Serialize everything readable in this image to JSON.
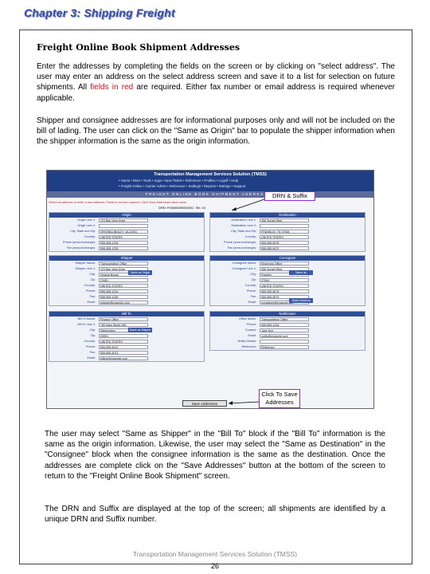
{
  "chapter": "Chapter 3:  Shipping Freight",
  "section_heading": "Freight Online Book Shipment Addresses",
  "paragraph1_before": "Enter the addresses by completing the fields on the screen or by clicking on \"select address\".  The user may enter an address on the select address screen and save it to a list for selection on future shipments.  All ",
  "paragraph1_red": "fields in red",
  "paragraph1_after": " are required.  Either fax number or email address is required whenever applicable.",
  "paragraph2": "Shipper and consignee addresses are for informational purposes only and will not be included on the bill of lading.  The user can click on the \"Same as Origin\" bar to populate the shipper information when the shipper information is the same as the origin information.",
  "screenshot": {
    "system_name": "Transportation Management Services Solution (TMSS)",
    "nav1": "• Home • Rein • Tools • Apps • New TMSS • Reference • Profiles • Logoff • Help",
    "nav2": "• Freight Online • Carrier Admin • Reference • Settings • Reports • Ratings • Support",
    "page_title": "FREIGHT ONLINE BOOK SHIPMENT ADDRESSES",
    "instruction": "Select an address or enter a new address. Fields in red are required. Click Save Addresses when done.",
    "drn_label": "DRN:",
    "drn_value": "F00000000000001",
    "suffix_label": "Sfx:",
    "suffix_value": "01",
    "origin_header": "Origin",
    "destination_header": "Destination",
    "shipper_header": "Shipper",
    "consignee_header": "Consignee",
    "billto_header": "Bill To",
    "notify_header": "Notification",
    "origin_fields": [
      {
        "label": "Origin Line 1:",
        "value": "123 Bay View Drive"
      },
      {
        "label": "Origin Line 2:",
        "value": ""
      },
      {
        "label": "City, State and Zip:",
        "value": "VIRGINIA BEACH, VA 23451"
      },
      {
        "label": "Country:",
        "value": "UNITED STATES"
      },
      {
        "label": "Phone (area-exchange):",
        "value": "555-555-1234"
      },
      {
        "label": "Fax (area-exchange):",
        "value": "555-555-1235"
      }
    ],
    "destination_fields": [
      {
        "label": "Destination Line 1:",
        "value": "456 Sunset Blvd"
      },
      {
        "label": "Destination Line 2:",
        "value": ""
      },
      {
        "label": "City, State and Zip:",
        "value": "FRANKLIN, TN 37064"
      },
      {
        "label": "Country:",
        "value": "UNITED STATES"
      },
      {
        "label": "Phone (area-exchange):",
        "value": "555-555-5678"
      },
      {
        "label": "Fax (area-exchange):",
        "value": "555-555-5679"
      }
    ],
    "shipper_fields": [
      {
        "label": "Shipper Name:",
        "value": "Transportation Office"
      },
      {
        "label": "Shipper Line 1:",
        "value": "123 Bay View Drive"
      },
      {
        "label": "City:",
        "value": "Virginia Beach"
      },
      {
        "label": "Zip:",
        "value": "23451"
      },
      {
        "label": "Country:",
        "value": "UNITED STATES"
      },
      {
        "label": "Phone:",
        "value": "555-555-1234"
      },
      {
        "label": "Fax:",
        "value": "555-555-1235"
      },
      {
        "label": "Email:",
        "value": "shipper@example.com"
      }
    ],
    "consignee_fields": [
      {
        "label": "Consignee Name:",
        "value": "Receiving Office"
      },
      {
        "label": "Consignee Line 1:",
        "value": "456 Sunset Blvd"
      },
      {
        "label": "City:",
        "value": "Franklin"
      },
      {
        "label": "Zip:",
        "value": "37064"
      },
      {
        "label": "Country:",
        "value": "UNITED STATES"
      },
      {
        "label": "Phone:",
        "value": "555-555-5678"
      },
      {
        "label": "Fax:",
        "value": "555-555-5679"
      },
      {
        "label": "Email:",
        "value": "consignee@example.com"
      }
    ],
    "billto_fields": [
      {
        "label": "Bill To Name:",
        "value": "Finance Office"
      },
      {
        "label": "Bill To Line 1:",
        "value": "789 Main Street NW"
      },
      {
        "label": "City:",
        "value": "Washington"
      },
      {
        "label": "Zip:",
        "value": "20001"
      },
      {
        "label": "Country:",
        "value": "UNITED STATES"
      },
      {
        "label": "Phone:",
        "value": "555-555-9012"
      },
      {
        "label": "Fax:",
        "value": "555-555-9013"
      },
      {
        "label": "Email:",
        "value": "billing@example.com"
      }
    ],
    "notify_fields": [
      {
        "label": "Office Name:",
        "value": "Transportation Office"
      },
      {
        "label": "Phone:",
        "value": "555-555-1234"
      },
      {
        "label": "Contact:",
        "value": "Jane Doe"
      },
      {
        "label": "Email:",
        "value": "notify@example.com"
      },
      {
        "label": "Notify Details:",
        "value": ""
      },
      {
        "label": "Reference:",
        "value": "Reference"
      }
    ],
    "same_as_origin": "Same as Origin",
    "same_as_destination": "Same as Destination",
    "same_as_shipper": "Same as Shipper",
    "select_address": "Select Address",
    "save_button": "Save Addresses"
  },
  "callout1": "DRN & Suffix",
  "callout2": "Click To Save Addresses",
  "paragraph3": "The user may select \"Same as Shipper\" in the \"Bill To\" block if the \"Bill To\" information is the same as the origin information.   Likewise, the user may select the \"Same as Destination\" in the \"Consignee\" block when the consignee information is the same as the destination.  Once the addresses are complete click on the \"Save Addresses\" button at the bottom of the screen to return to the \"Freight Online Book Shipment\" screen.",
  "paragraph4": "The DRN and Suffix are displayed at the top of the screen; all shipments are identified by a unique DRN and Suffix number.",
  "footer": "Transportation Management Services Solution (TMSS)",
  "page_number": "26"
}
